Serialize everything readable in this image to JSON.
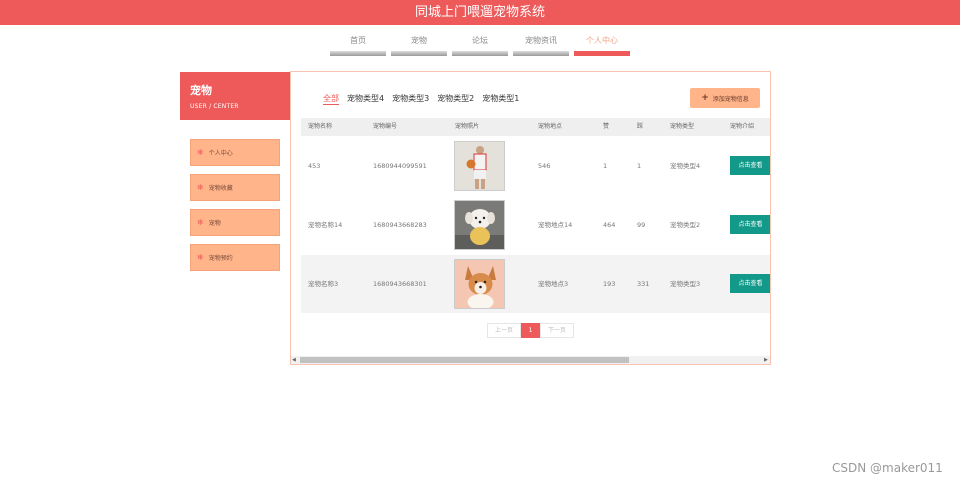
{
  "header": {
    "title": "同城上门喂遛宠物系统"
  },
  "nav": [
    {
      "label": "首页",
      "active": false
    },
    {
      "label": "宠物",
      "active": false
    },
    {
      "label": "论坛",
      "active": false
    },
    {
      "label": "宠物资讯",
      "active": false
    },
    {
      "label": "个人中心",
      "active": true
    }
  ],
  "sidebar": {
    "title": "宠物",
    "subtitle": "USER / CENTER",
    "items": [
      {
        "label": "个人中心"
      },
      {
        "label": "宠物收藏"
      },
      {
        "label": "宠物"
      },
      {
        "label": "宠物预约"
      }
    ]
  },
  "filters": {
    "items": [
      {
        "label": "全部",
        "active": true
      },
      {
        "label": "宠物类型4",
        "active": false
      },
      {
        "label": "宠物类型3",
        "active": false
      },
      {
        "label": "宠物类型2",
        "active": false
      },
      {
        "label": "宠物类型1",
        "active": false
      }
    ],
    "add_label": "添加宠物信息"
  },
  "table": {
    "headers": [
      "宠物名称",
      "宠物编号",
      "宠物照片",
      "宠物地点",
      "赞",
      "踩",
      "宠物类型",
      "宠物介绍"
    ],
    "rows": [
      {
        "name": "453",
        "code": "1680944099591",
        "photo": "person-basketball",
        "place": "546",
        "like": "1",
        "dislike": "1",
        "type": "宠物类型4",
        "action": "点击查看"
      },
      {
        "name": "宠物名称14",
        "code": "1680943668283",
        "photo": "white-dog",
        "place": "宠物地点14",
        "like": "464",
        "dislike": "99",
        "type": "宠物类型2",
        "action": "点击查看"
      },
      {
        "name": "宠物名称3",
        "code": "1680943668301",
        "photo": "corgi-dog",
        "place": "宠物地点3",
        "like": "193",
        "dislike": "331",
        "type": "宠物类型3",
        "action": "点击查看"
      }
    ]
  },
  "pagination": {
    "prev": "上一页",
    "current": "1",
    "next": "下一页"
  },
  "watermark": "CSDN @maker011",
  "colors": {
    "primary": "#ee5a5a",
    "accent": "#ffb48a",
    "button": "#12998a"
  }
}
